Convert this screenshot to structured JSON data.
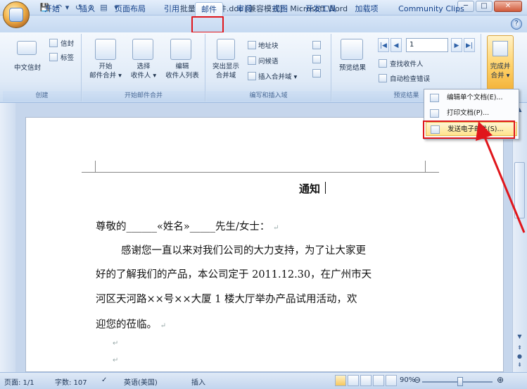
{
  "window": {
    "title": "批量发送邮件.doc [兼容模式] - Microsoft Word",
    "controls": [
      "─",
      "□",
      "✕"
    ]
  },
  "quick_access": [
    "💾",
    "↶",
    "▾",
    "↺",
    "⊘",
    "▤",
    "▾"
  ],
  "tabs": [
    {
      "label": "开始"
    },
    {
      "label": "插入"
    },
    {
      "label": "页面布局"
    },
    {
      "label": "引用"
    },
    {
      "label": "邮件",
      "active": true
    },
    {
      "label": "审阅"
    },
    {
      "label": "视图"
    },
    {
      "label": "开发工具"
    },
    {
      "label": "加载项"
    },
    {
      "label": "Community Clips"
    }
  ],
  "ribbon": {
    "create": {
      "label": "创建",
      "chinese_envelope": "中文信封",
      "envelope": "信封",
      "labels": "标签"
    },
    "start_merge": {
      "label": "开始邮件合并",
      "start": [
        "开始",
        "邮件合并 ▾"
      ],
      "select": [
        "选择",
        "收件人 ▾"
      ],
      "edit": [
        "编辑",
        "收件人列表"
      ]
    },
    "write_insert": {
      "label": "编写和插入域",
      "highlight": [
        "突出显示",
        "合并域"
      ],
      "address_block": "地址块",
      "greeting": "问候语",
      "insert_field": "插入合并域 ▾"
    },
    "preview": {
      "label": "预览结果",
      "preview_results": "预览结果",
      "record": "1",
      "find_recipient": "查找收件人",
      "auto_check": "自动检查错误"
    },
    "finish": {
      "label": [
        "完成并",
        "合并 ▾"
      ]
    }
  },
  "menu": {
    "items": [
      {
        "label": "编辑单个文档(E)..."
      },
      {
        "label": "打印文档(P)..."
      },
      {
        "label": "发送电子邮件(S)..."
      }
    ]
  },
  "document": {
    "title": "通知",
    "salutation": "尊敬的______«姓名»_____先生/女士：",
    "lines": [
      "感谢您一直以来对我们公司的大力支持，为了让大家更",
      "好的了解我们的产品，本公司定于 2011.12.30，在广州市天",
      "河区天河路××号××大厦 1 楼大厅举办产品试用活动，欢",
      "迎您的莅临。"
    ],
    "para_mark": "↵"
  },
  "status": {
    "page": "页面: 1/1",
    "words": "字数: 107",
    "language": "英语(美国)",
    "mode": "插入",
    "zoom": "90%",
    "zoom_minus": "⊖",
    "zoom_plus": "⊕"
  },
  "colors": {
    "highlight": "#e0161c",
    "ribbon": "#dfeaf7",
    "menu_hover": "#ffe38c"
  }
}
